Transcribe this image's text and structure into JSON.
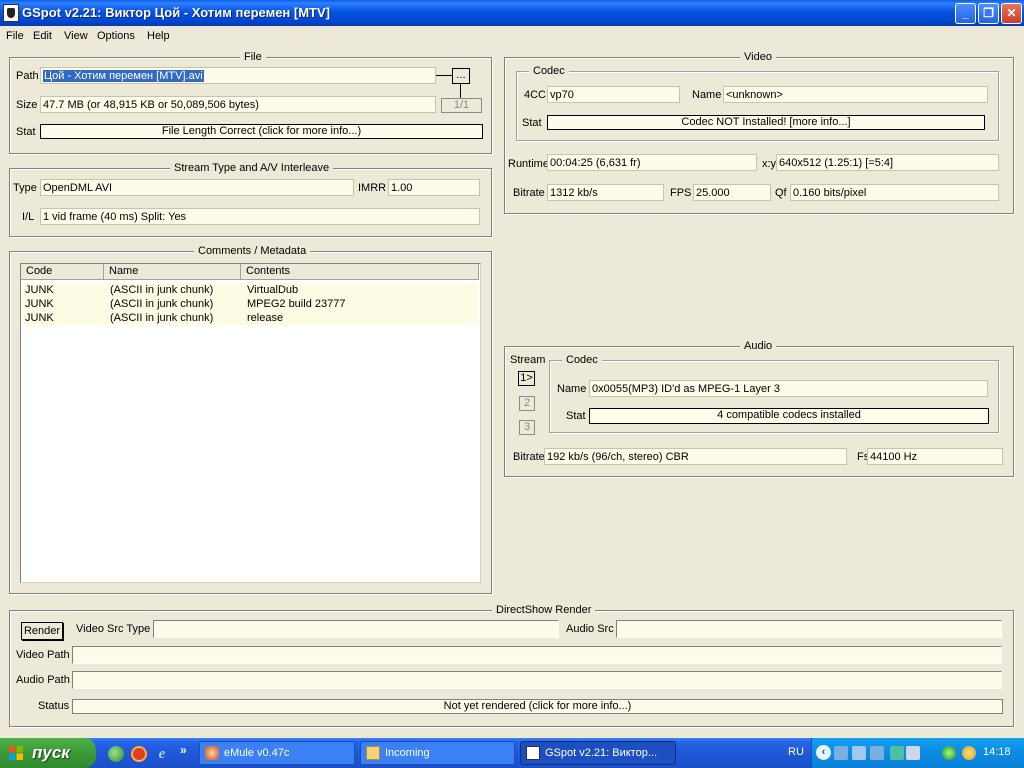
{
  "window": {
    "title": "GSpot v2.21: Виктор Цой - Хотим перемен [MTV]",
    "minimize_glyph": "_",
    "restore_glyph": "❐",
    "close_glyph": "✕"
  },
  "menu": [
    "File",
    "Edit",
    "View",
    "Options",
    "Help"
  ],
  "file": {
    "group_title": "File",
    "path_label": "Path",
    "path_value": "Цой - Хотим перемен [MTV].avi",
    "browse_label": "...",
    "size_label": "Size",
    "size_value": "47.7 MB (or 48,915 KB or 50,089,506 bytes)",
    "page_indicator": "1/1",
    "stat_label": "Stat",
    "stat_value": "File Length Correct (click for more info...)"
  },
  "stream": {
    "group_title": "Stream Type and A/V Interleave",
    "type_label": "Type",
    "type_value": "OpenDML AVI",
    "imrr_label": "IMRR",
    "imrr_value": "1.00",
    "il_label": "I/L",
    "il_value": "1 vid frame (40 ms)  Split: Yes"
  },
  "comments": {
    "group_title": "Comments / Metadata",
    "columns": [
      "Code",
      "Name",
      "Contents"
    ],
    "rows": [
      {
        "code": "JUNK",
        "name": "(ASCII in junk chunk)",
        "contents": "VirtualDub"
      },
      {
        "code": "JUNK",
        "name": "(ASCII in junk chunk)",
        "contents": "MPEG2 build 23777"
      },
      {
        "code": "JUNK",
        "name": "(ASCII in junk chunk)",
        "contents": "release"
      }
    ]
  },
  "video": {
    "group_title": "Video",
    "codec_title": "Codec",
    "fourcc_label": "4CC",
    "fourcc_value": "vp70",
    "name_label": "Name",
    "name_value": "<unknown>",
    "stat_label": "Stat",
    "stat_value": "Codec NOT Installed!  [more info...]",
    "runtime_label": "Runtime",
    "runtime_value": "00:04:25 (6,631 fr)",
    "xy_label": "x:y",
    "xy_value": "640x512 (1.25:1) [=5:4]",
    "bitrate_label": "Bitrate",
    "bitrate_value": "1312 kb/s",
    "fps_label": "FPS",
    "fps_value": "25.000",
    "qf_label": "Qf",
    "qf_value": "0.160 bits/pixel"
  },
  "audio": {
    "group_title": "Audio",
    "stream_label": "Stream",
    "codec_title": "Codec",
    "stream_buttons": [
      "1>",
      "2",
      "3"
    ],
    "name_label": "Name",
    "name_value": "0x0055(MP3) ID'd as MPEG-1 Layer 3",
    "stat_label": "Stat",
    "stat_value": "4 compatible codecs installed",
    "bitrate_label": "Bitrate",
    "bitrate_value": "192 kb/s (96/ch, stereo) CBR",
    "fs_label": "Fs",
    "fs_value": "44100 Hz"
  },
  "directshow": {
    "group_title": "DirectShow Render",
    "render_label": "Render",
    "video_src_type_label": "Video Src Type",
    "video_src_type_value": "",
    "audio_src_label": "Audio Src",
    "audio_src_value": "",
    "video_path_label": "Video Path",
    "video_path_value": "",
    "audio_path_label": "Audio Path",
    "audio_path_value": "",
    "status_label": "Status",
    "status_value": "Not yet rendered (click for more info...)"
  },
  "taskbar": {
    "start_label": "пуск",
    "quicklaunch_more": "»",
    "tasks": [
      "eMule v0.47c",
      "Incoming",
      "GSpot v2.21: Виктор..."
    ],
    "language": "RU",
    "clock": "14:18"
  },
  "colors": {
    "field_bg": "#fdfbe9",
    "titlebar": "#0554e3",
    "taskbar": "#2058d8",
    "start_green": "#3a9a36",
    "tray": "#0c8be3"
  }
}
